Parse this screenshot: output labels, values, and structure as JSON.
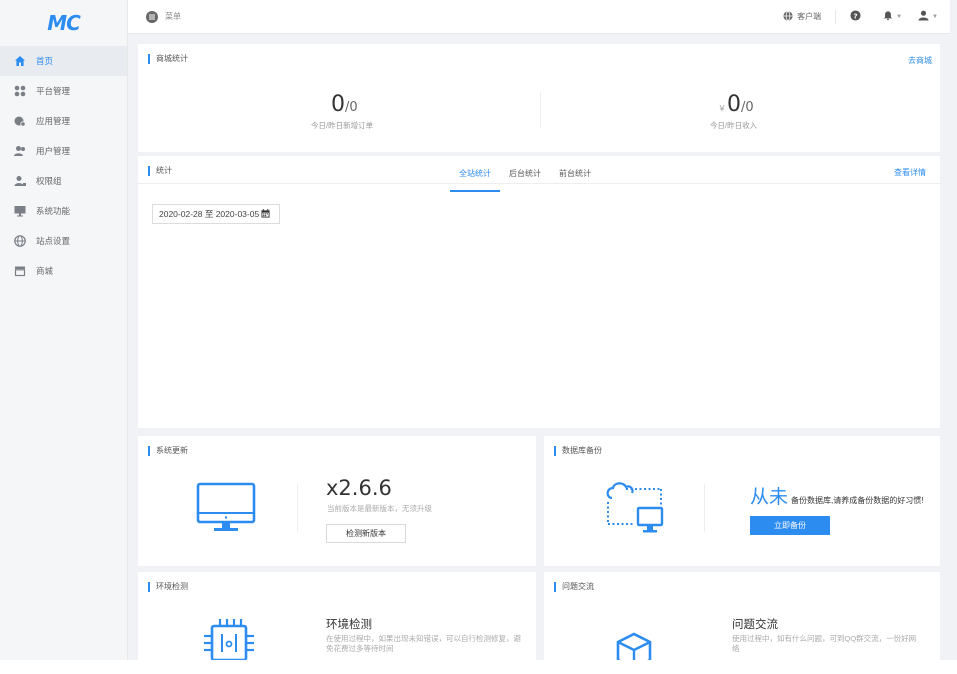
{
  "app": {
    "logo": "MC"
  },
  "sidebar": {
    "items": [
      {
        "label": "首页",
        "icon": "home-icon"
      },
      {
        "label": "平台管理",
        "icon": "grid-icon"
      },
      {
        "label": "应用管理",
        "icon": "app-icon"
      },
      {
        "label": "用户管理",
        "icon": "users-icon"
      },
      {
        "label": "权限组",
        "icon": "user-group-icon"
      },
      {
        "label": "系统功能",
        "icon": "monitor-icon"
      },
      {
        "label": "站点设置",
        "icon": "globe-icon"
      },
      {
        "label": "商城",
        "icon": "store-icon"
      }
    ]
  },
  "topbar": {
    "menu_label": "菜单",
    "client_label": "客户端"
  },
  "mall_stats": {
    "title": "商城统计",
    "link": "去商城",
    "orders": {
      "value": "0",
      "prev": "/0",
      "label": "今日/昨日新增订单"
    },
    "income": {
      "prefix": "￥",
      "value": "0",
      "prev": "/0",
      "label": "今日/昨日收入"
    }
  },
  "stats": {
    "title": "统计",
    "tabs": [
      "全站统计",
      "后台统计",
      "前台统计"
    ],
    "active_tab": 0,
    "link": "查看详情",
    "date_range": "2020-02-28 至 2020-03-05"
  },
  "system_update": {
    "title": "系统更新",
    "version": "x2.6.6",
    "desc": "当前版本是最新版本，无须升级",
    "button": "检测新版本"
  },
  "db_backup": {
    "title": "数据库备份",
    "big": "从未",
    "text": "备份数据库,请养成备份数据的好习惯!",
    "button": "立即备份"
  },
  "env_check": {
    "title": "环境检测",
    "headline": "环境检测",
    "desc": "在使用过程中，如果出现未知错误，可以自行检测修复，避免花费过多等待时间"
  },
  "qa": {
    "title": "问题交流",
    "headline": "问题交流",
    "desc": "使用过程中，如有什么问题，可到QQ群交流，一份好网络"
  },
  "colors": {
    "accent": "#2d8cf0"
  }
}
